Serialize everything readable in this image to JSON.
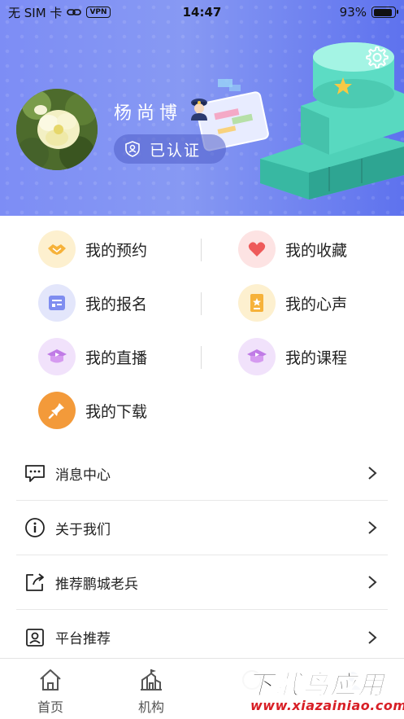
{
  "status_bar": {
    "carrier": "无 SIM 卡",
    "vpn": "VPN",
    "time": "14:47",
    "battery": "93%"
  },
  "profile": {
    "name": "杨尚博",
    "verify_label": "已认证"
  },
  "grid": [
    [
      {
        "label": "我的预约",
        "icon": "handshake-icon",
        "bg": "#fdf0cf"
      },
      {
        "label": "我的收藏",
        "icon": "heart-icon",
        "bg": "#fde3e3"
      }
    ],
    [
      {
        "label": "我的报名",
        "icon": "form-icon",
        "bg": "#e3e6fb"
      },
      {
        "label": "我的心声",
        "icon": "notebook-icon",
        "bg": "#fdf0cf"
      }
    ],
    [
      {
        "label": "我的直播",
        "icon": "live-icon",
        "bg": "#f1e2fb"
      },
      {
        "label": "我的课程",
        "icon": "course-icon",
        "bg": "#f1e2fb"
      }
    ],
    [
      {
        "label": "我的下载",
        "icon": "download-icon",
        "bg": "#f39a3a"
      }
    ]
  ],
  "list": [
    {
      "label": "消息中心",
      "icon": "message-icon"
    },
    {
      "label": "关于我们",
      "icon": "info-icon"
    },
    {
      "label": "推荐鹏城老兵",
      "icon": "share-icon"
    },
    {
      "label": "平台推荐",
      "icon": "contact-card-icon"
    }
  ],
  "tabs": [
    {
      "label": "首页",
      "icon": "home-icon"
    },
    {
      "label": "机构",
      "icon": "institution-icon"
    }
  ],
  "watermark": {
    "top": "下载鸟应用",
    "bottom": "www.xiazainiao.com"
  },
  "colors": {
    "hero_start": "#7d8df5",
    "hero_end": "#5e72ee",
    "accent_orange": "#f39a3a",
    "accent_red": "#ee5a5a",
    "watermark_red": "#d81f26"
  }
}
